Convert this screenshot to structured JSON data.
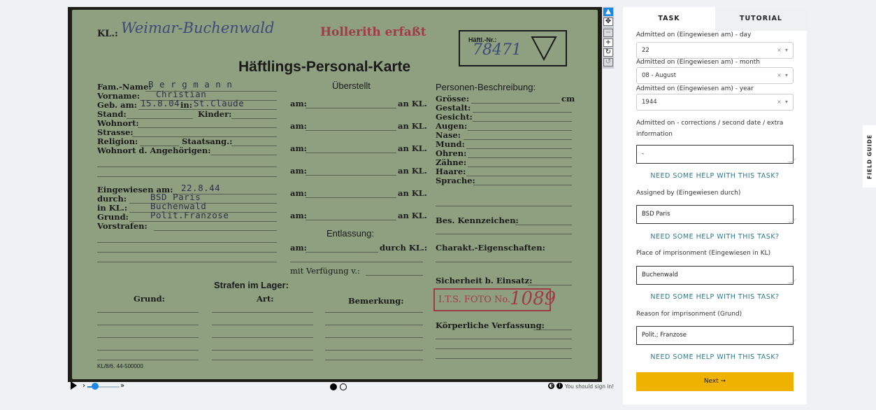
{
  "card": {
    "kl_label": "KL.:",
    "kl_hand": "Weimar-Buchenwald",
    "hollerith_stamp": "Hollerith erfaßt",
    "haftl_nr_label": "Häftl.-Nr.:",
    "haftl_nr_value": "78471",
    "title": "Häftlings-Personal-Karte",
    "fam_name_label": "Fam.-Name:",
    "fam_name_value": "B e r g m a n n",
    "vorname_label": "Vorname:",
    "vorname_value": "Christian",
    "geb_label": "Geb. am:",
    "geb_value": "15.8.04",
    "in_label": "in:",
    "in_value": "St.Claude",
    "stand_label": "Stand:",
    "kinder_label": "Kinder:",
    "wohnort_label": "Wohnort:",
    "strasse_label": "Strasse:",
    "religion_label": "Religion:",
    "staatsang_label": "Staatsang.:",
    "wohnort_ang_label": "Wohnort d. Angehörigen:",
    "eingewiesen_label": "Eingewiesen am:",
    "eingewiesen_value": "22.8.44",
    "durch_label": "durch:",
    "durch_value": "BSD Paris",
    "inkl_label": "in KL.:",
    "inkl_value": "Buchenwald",
    "grund_label": "Grund:",
    "grund_value": "Polit.Franzose",
    "vorstrafen_label": "Vorstrafen:",
    "ueberstellt": "Überstellt",
    "am_label": "am:",
    "an_kl_label": "an KL.",
    "entlassung": "Entlassung:",
    "durch_kl_label": "durch KL.:",
    "mit_verfuegung": "mit Verfügung v.:",
    "personen": "Personen-Beschreibung:",
    "groesse": "Grösse:",
    "cm": "cm",
    "gestalt": "Gestalt:",
    "gesicht": "Gesicht:",
    "augen": "Augen:",
    "nase": "Nase:",
    "mund": "Mund:",
    "ohren": "Ohren:",
    "zaehne": "Zähne:",
    "haare": "Haare:",
    "sprache": "Sprache:",
    "bes_kennzeichen": "Bes. Kennzeichen:",
    "charakt": "Charakt.-Eigenschaften:",
    "sicherheit": "Sicherheit b. Einsatz:",
    "foto_stamp": "I.T.S. FOTO No.",
    "foto_no": "1089",
    "koerperliche": "Körperliche Verfassung:",
    "strafen": "Strafen im Lager:",
    "grund_col": "Grund:",
    "art_col": "Art:",
    "bemerkung_col": "Bemerkung:",
    "form_code": "KL/8/6. 44-500000"
  },
  "viewer": {
    "sign_in_text": "You should sign in!",
    "frames": 2,
    "current_frame": 1
  },
  "tabs": {
    "task": "TASK",
    "tutorial": "TUTORIAL"
  },
  "task": {
    "day_label": "Admitted on (Eingewiesen am) - day",
    "day_value": "22",
    "month_label": "Admitted on (Eingewiesen am) - month",
    "month_value": "08 - August",
    "year_label": "Admitted on (Eingewiesen am) - year",
    "year_value": "1944",
    "corrections_label": "Admitted on - corrections / second date / extra information",
    "corrections_value": "-",
    "help_text": "NEED SOME HELP WITH THIS TASK?",
    "assigned_label": "Assigned by (Eingewiesen durch)",
    "assigned_value": "BSD Paris",
    "place_label": "Place of imprisonment (Eingewiesen in KL)",
    "place_value": "Buchenwald",
    "reason_label": "Reason for imprisonment (Grund)",
    "reason_value": "Polit.; Franzose",
    "next_label": "Next ➞",
    "clear_glyph": "×",
    "arrow_glyph": "▾"
  },
  "field_guide": "FIELD GUIDE",
  "colors": {
    "accent": "#f0b200",
    "help_link": "#2b7a8c",
    "viewer_active": "#1e88e5"
  }
}
